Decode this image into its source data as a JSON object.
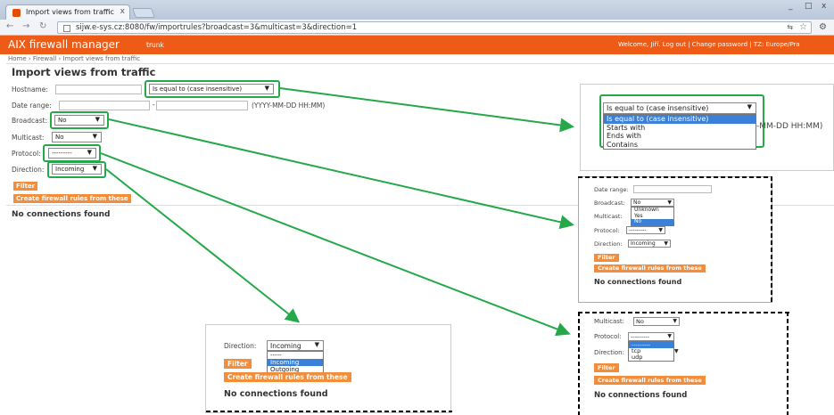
{
  "browser": {
    "tab_title": "Import views from traffic",
    "tab_close": "x",
    "url": "sijw.e-sys.cz:8080/fw/importrules?broadcast=3&multicast=3&direction=1",
    "window_buttons": [
      "_",
      "□",
      "x"
    ]
  },
  "app": {
    "brand": "AIX firewall manager",
    "branch": "trunk",
    "user_bar": "Welcome, Jiří. Log out | Change password | TZ: Europe/Pra"
  },
  "breadcrumb": "Home › Firewall › Import views from traffic",
  "page": {
    "title": "Import views from traffic",
    "hostname_label": "Hostname:",
    "hostname_match": "Is equal to (case insensitive)",
    "daterange_label": "Date range:",
    "daterange_sep": "-",
    "daterange_hint": "(YYYY-MM-DD HH:MM)",
    "broadcast_label": "Broadcast:",
    "broadcast_value": "No",
    "multicast_label": "Multicast:",
    "multicast_value": "No",
    "protocol_label": "Protocol:",
    "protocol_value": "---------",
    "direction_label": "Direction:",
    "direction_value": "Incoming",
    "filter_button": "Filter",
    "create_button": "Create firewall rules from these",
    "no_connections": "No connections found"
  },
  "callouts": {
    "hostname_dropdown": {
      "selected": "Is equal to (case insensitive)",
      "options": [
        "Is equal to (case insensitive)",
        "Starts with",
        "Ends with",
        "Contains"
      ],
      "trailing_hint": "-MM-DD HH:MM)"
    },
    "broadcast_dropdown": {
      "daterange_label": "Date range:",
      "broadcast_label": "Broadcast:",
      "selected": "No",
      "options": [
        "Unknown",
        "Yes",
        "No"
      ],
      "multicast_label": "Multicast:",
      "protocol_label": "Protocol:",
      "protocol_value": "---------",
      "direction_label": "Direction:",
      "direction_value": "Incoming",
      "filter_button": "Filter",
      "create_button": "Create firewall rules from these",
      "no_connections": "No connections found"
    },
    "direction_dropdown": {
      "label": "Direction:",
      "selected": "Incoming",
      "options": [
        "-----",
        "Incoming",
        "Outgoing"
      ],
      "filter_button": "Filter",
      "create_button": "Create firewall rules from these",
      "no_connections": "No connections found"
    },
    "protocol_dropdown": {
      "multicast_label": "Multicast:",
      "multicast_value": "No",
      "protocol_label": "Protocol:",
      "selected": "---------",
      "options": [
        "---------",
        "tcp",
        "udp"
      ],
      "direction_label": "Direction:",
      "filter_button": "Filter",
      "create_button": "Create firewall rules from these",
      "no_connections": "No connections found"
    }
  },
  "colors": {
    "accent_orange": "#ed5b17",
    "button_orange": "#f28d3c",
    "highlight_green": "#24a84a",
    "selected_blue": "#3a80d8"
  }
}
